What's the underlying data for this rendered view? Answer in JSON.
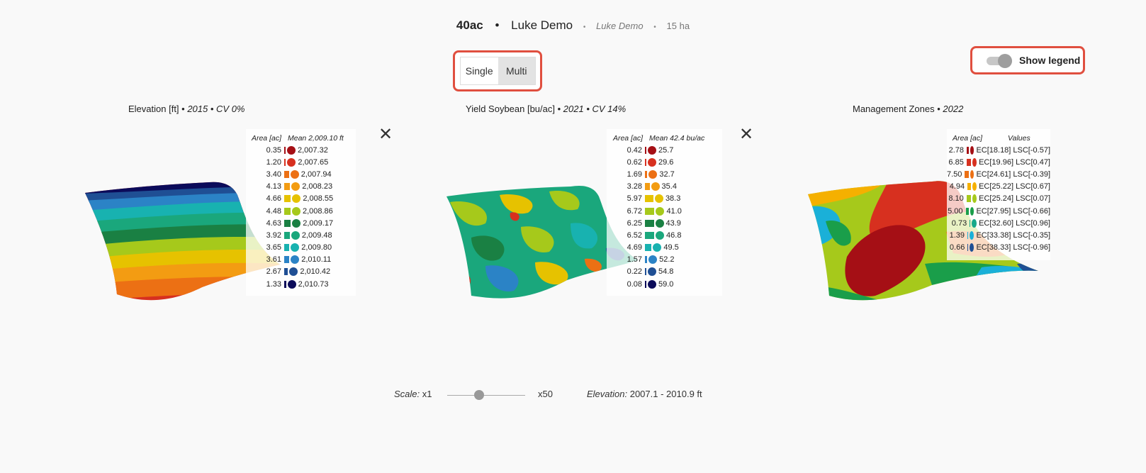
{
  "header": {
    "field_name": "40ac",
    "separator": "•",
    "farm_name": "Luke Demo",
    "small_separator": "•",
    "farm_sub": "Luke Demo",
    "small_separator2": "•",
    "area": "15 ha"
  },
  "mode_toggle": {
    "single": "Single",
    "multi": "Multi",
    "selected": "Multi"
  },
  "legend_toggle": {
    "label": "Show legend",
    "on": true
  },
  "panels": [
    {
      "title_main": "Elevation [ft] •",
      "title_italic": "2015 • CV 0%",
      "close_symbol": "✕",
      "legend": {
        "col_area": "Area [ac]",
        "col_value": "Mean 2,009.10 ft",
        "rows": [
          {
            "area": "0.35",
            "value": "2,007.32",
            "color": "#a50f15"
          },
          {
            "area": "1.20",
            "value": "2,007.65",
            "color": "#d7301f"
          },
          {
            "area": "3.40",
            "value": "2,007.94",
            "color": "#ec7014"
          },
          {
            "area": "4.13",
            "value": "2,008.23",
            "color": "#f39c12"
          },
          {
            "area": "4.66",
            "value": "2,008.55",
            "color": "#e6c200"
          },
          {
            "area": "4.48",
            "value": "2,008.86",
            "color": "#a6c91b"
          },
          {
            "area": "4.63",
            "value": "2,009.17",
            "color": "#1a8043"
          },
          {
            "area": "3.92",
            "value": "2,009.48",
            "color": "#1aa77c"
          },
          {
            "area": "3.65",
            "value": "2,009.80",
            "color": "#18b2b0"
          },
          {
            "area": "3.61",
            "value": "2,010.11",
            "color": "#2b83c6"
          },
          {
            "area": "2.67",
            "value": "2,010.42",
            "color": "#1f4f94"
          },
          {
            "area": "1.33",
            "value": "2,010.73",
            "color": "#0b0b5a"
          }
        ]
      }
    },
    {
      "title_main": "Yield Soybean [bu/ac] •",
      "title_italic": "2021 • CV 14%",
      "close_symbol": "✕",
      "legend": {
        "col_area": "Area [ac]",
        "col_value": "Mean 42.4 bu/ac",
        "rows": [
          {
            "area": "0.42",
            "value": "25.7",
            "color": "#a50f15"
          },
          {
            "area": "0.62",
            "value": "29.6",
            "color": "#d7301f"
          },
          {
            "area": "1.69",
            "value": "32.7",
            "color": "#ec7014"
          },
          {
            "area": "3.28",
            "value": "35.4",
            "color": "#f39c12"
          },
          {
            "area": "5.97",
            "value": "38.3",
            "color": "#e6c200"
          },
          {
            "area": "6.72",
            "value": "41.0",
            "color": "#a6c91b"
          },
          {
            "area": "6.25",
            "value": "43.9",
            "color": "#1a8043"
          },
          {
            "area": "6.52",
            "value": "46.8",
            "color": "#1aa77c"
          },
          {
            "area": "4.69",
            "value": "49.5",
            "color": "#18b2b0"
          },
          {
            "area": "1.57",
            "value": "52.2",
            "color": "#2b83c6"
          },
          {
            "area": "0.22",
            "value": "54.8",
            "color": "#1f4f94"
          },
          {
            "area": "0.08",
            "value": "59.0",
            "color": "#0b0b5a"
          }
        ]
      }
    },
    {
      "title_main": "Management Zones •",
      "title_italic": "2022",
      "legend": {
        "col_area": "Area [ac]",
        "col_value": "Values",
        "rows": [
          {
            "area": "2.78",
            "value": "EC[18.18] LSC[-0.57]",
            "color": "#a50f15"
          },
          {
            "area": "6.85",
            "value": "EC[19.96] LSC[0.47]",
            "color": "#d7301f"
          },
          {
            "area": "7.50",
            "value": "EC[24.61] LSC[-0.39]",
            "color": "#ec7014"
          },
          {
            "area": "4.94",
            "value": "EC[25.22] LSC[0.67]",
            "color": "#f5b000"
          },
          {
            "area": "8.10",
            "value": "EC[25.24] LSC[0.07]",
            "color": "#a6c91b"
          },
          {
            "area": "5.00",
            "value": "EC[27.95] LSC[-0.66]",
            "color": "#1a9e4a"
          },
          {
            "area": "0.73",
            "value": "EC[32.60] LSC[0.96]",
            "color": "#18a88a"
          },
          {
            "area": "1.39",
            "value": "EC[33.38] LSC[-0.35]",
            "color": "#1ab0d8"
          },
          {
            "area": "0.66",
            "value": "EC[38.33] LSC[-0.96]",
            "color": "#1f4f94"
          }
        ]
      }
    }
  ],
  "bottom": {
    "scale_label": "Scale:",
    "scale_min": "x1",
    "scale_max": "x50",
    "scale_level": 0.4,
    "elev_label": "Elevation:",
    "elev_value": "2007.1 - 2010.9 ft"
  }
}
